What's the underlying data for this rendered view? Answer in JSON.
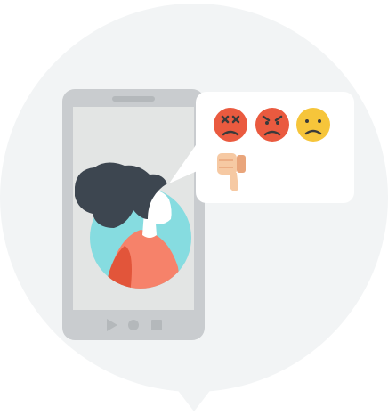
{
  "illustration": {
    "colors": {
      "backdrop": "#f2f4f5",
      "phone_body": "#c9cccf",
      "phone_screen": "#e3e5e4",
      "phone_buttons": "#b4b8bb",
      "bubble": "#ffffff",
      "avatar_bg": "#86dce0",
      "hair": "#3d4650",
      "skin": "#ffffff",
      "shirt": "#f6826a",
      "shirt_shade": "#e2553a",
      "emoji_red": "#ea5a3f",
      "emoji_yellow": "#f6c53a",
      "emoji_face_ink": "#3a3a3a",
      "thumb": "#f6c9a3",
      "thumb_shade": "#e9a57b"
    },
    "icons": {
      "phone": "smartphone-icon",
      "person": "person-avatar-icon",
      "emoji_1": "dizzy-face-icon",
      "emoji_2": "angry-face-icon",
      "emoji_3": "frowning-face-icon",
      "feedback": "thumbs-down-icon",
      "nav_back": "play-back-icon",
      "nav_home": "home-circle-icon",
      "nav_recent": "square-recent-icon"
    }
  }
}
